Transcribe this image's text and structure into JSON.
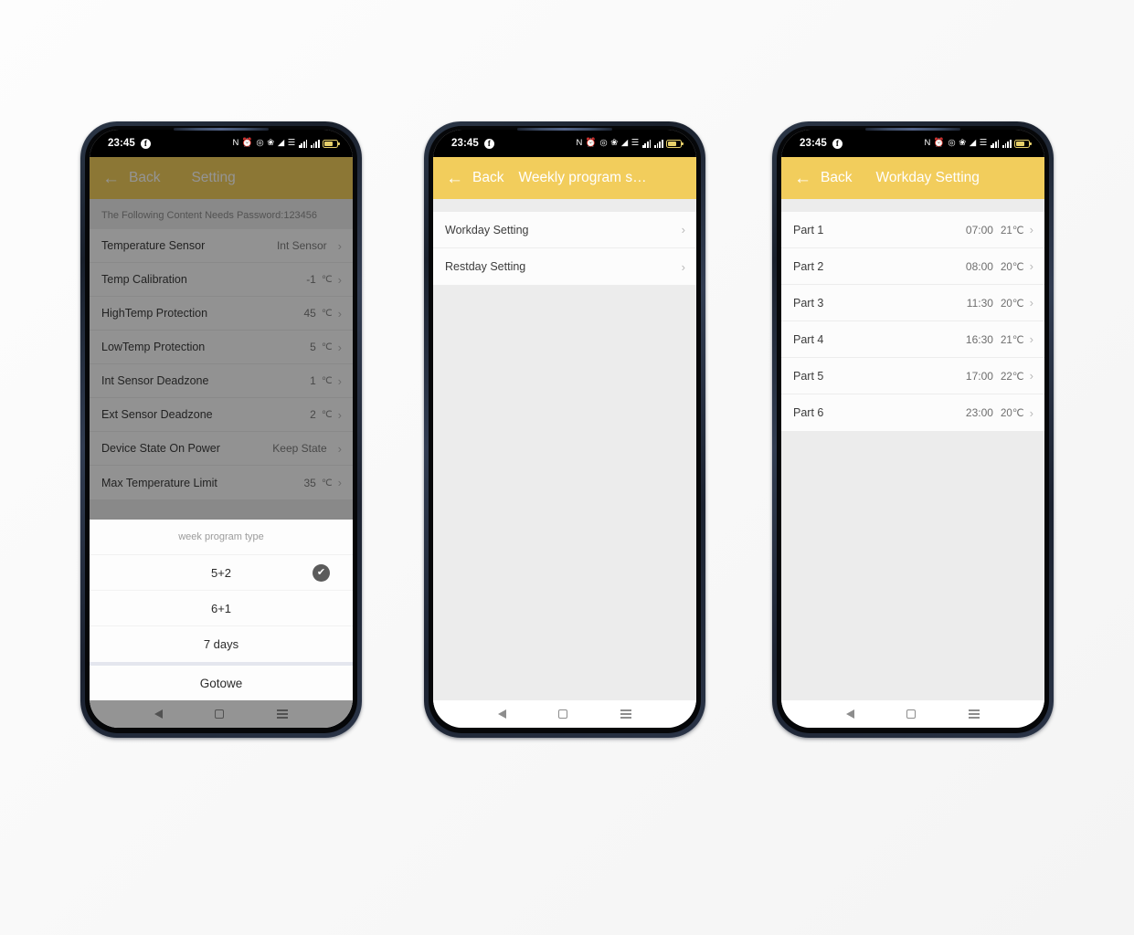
{
  "statusbar": {
    "time": "23:45",
    "app_badge": "f",
    "icons": [
      "nfc-icon",
      "alarm-icon",
      "location-icon",
      "bluetooth-icon",
      "wifi-icon",
      "vibrate-icon",
      "signal-1-icon",
      "signal-2-icon",
      "battery-icon"
    ]
  },
  "navbar": {
    "back": "nav-back-icon",
    "home": "nav-home-icon",
    "menu": "nav-menu-icon"
  },
  "phone1": {
    "appbar": {
      "back_label": "Back",
      "title": "Setting"
    },
    "note": "The Following Content Needs Password:123456",
    "rows": [
      {
        "label": "Temperature Sensor",
        "value": "Int Sensor",
        "unit": ""
      },
      {
        "label": "Temp Calibration",
        "value": "-1",
        "unit": "℃"
      },
      {
        "label": "HighTemp Protection",
        "value": "45",
        "unit": "℃"
      },
      {
        "label": "LowTemp Protection",
        "value": "5",
        "unit": "℃"
      },
      {
        "label": "Int Sensor Deadzone",
        "value": "1",
        "unit": "℃"
      },
      {
        "label": "Ext Sensor Deadzone",
        "value": "2",
        "unit": "℃"
      },
      {
        "label": "Device State On Power",
        "value": "Keep State",
        "unit": ""
      },
      {
        "label": "Max Temperature Limit",
        "value": "35",
        "unit": "℃"
      }
    ],
    "sheet": {
      "title": "week program type",
      "options": [
        {
          "label": "5+2",
          "selected": true
        },
        {
          "label": "6+1",
          "selected": false
        },
        {
          "label": "7 days",
          "selected": false
        }
      ],
      "check_glyph": "✔",
      "done_label": "Gotowe"
    }
  },
  "phone2": {
    "appbar": {
      "back_label": "Back",
      "title": "Weekly program s…"
    },
    "rows": [
      {
        "label": "Workday Setting"
      },
      {
        "label": "Restday Setting"
      }
    ]
  },
  "phone3": {
    "appbar": {
      "back_label": "Back",
      "title": "Workday Setting"
    },
    "rows": [
      {
        "label": "Part 1",
        "time": "07:00",
        "temp": "21℃"
      },
      {
        "label": "Part 2",
        "time": "08:00",
        "temp": "20℃"
      },
      {
        "label": "Part 3",
        "time": "11:30",
        "temp": "20℃"
      },
      {
        "label": "Part 4",
        "time": "16:30",
        "temp": "21℃"
      },
      {
        "label": "Part 5",
        "time": "17:00",
        "temp": "22℃"
      },
      {
        "label": "Part 6",
        "time": "23:00",
        "temp": "20℃"
      }
    ]
  },
  "colors": {
    "accent": "#F2CD5C",
    "accent_dimmed": "#8D7627",
    "list_bg": "#FCFCFC",
    "page_bg": "#ECECEC",
    "check_circle": "#5B5B5B"
  },
  "glyphs": {
    "chevron": "›",
    "arrow_left": "←"
  }
}
